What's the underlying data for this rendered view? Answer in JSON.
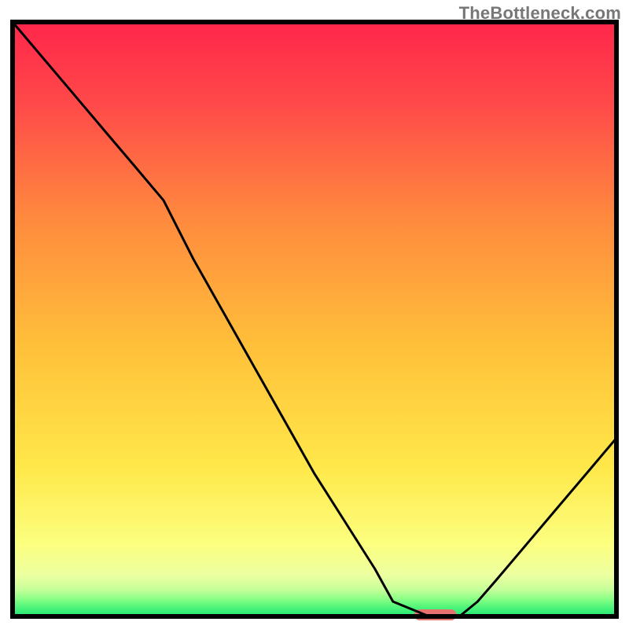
{
  "watermark": "TheBottleneck.com",
  "chart_data": {
    "type": "line",
    "title": "",
    "xlabel": "",
    "ylabel": "",
    "xlim": [
      0,
      100
    ],
    "ylim": [
      0,
      100
    ],
    "grid": false,
    "legend": false,
    "series": [
      {
        "name": "bottleneck-curve",
        "color": "#000000",
        "x": [
          0,
          5,
          10,
          15,
          20,
          25,
          30,
          35,
          40,
          45,
          50,
          55,
          60,
          63,
          69,
          74,
          77,
          80,
          85,
          90,
          95,
          100
        ],
        "values": [
          100,
          94,
          88,
          82,
          76,
          70,
          60,
          51,
          42,
          33,
          24,
          16,
          8,
          2.5,
          0,
          0,
          2.5,
          6,
          12,
          18,
          24,
          30
        ]
      }
    ],
    "gradient_bands": [
      {
        "name": "red",
        "color_top": "#ff264a",
        "color_bottom": "#ff7a3c",
        "from_pct": 100,
        "to_pct": 60
      },
      {
        "name": "orange",
        "color_top": "#ff7a3c",
        "color_bottom": "#ffd23a",
        "from_pct": 60,
        "to_pct": 30
      },
      {
        "name": "yellow",
        "color_top": "#ffd23a",
        "color_bottom": "#fff77a",
        "from_pct": 30,
        "to_pct": 8
      },
      {
        "name": "yellow2",
        "color_top": "#fff77a",
        "color_bottom": "#f2ff9a",
        "from_pct": 8,
        "to_pct": 4
      },
      {
        "name": "green",
        "color_top": "#8bff7a",
        "color_bottom": "#22e870",
        "from_pct": 4,
        "to_pct": 0
      }
    ],
    "optimal_marker": {
      "x_pct": 70,
      "y_pct": 0,
      "width_pct": 7,
      "color": "#e8726d"
    },
    "frame_color": "#000000"
  }
}
